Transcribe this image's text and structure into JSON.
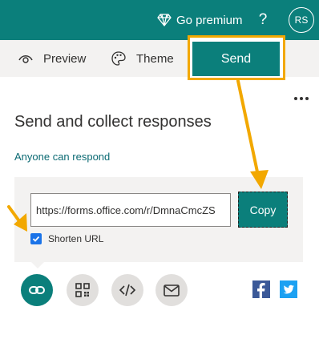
{
  "header": {
    "premium_label": "Go premium",
    "help_label": "?",
    "avatar_initials": "RS",
    "brand_color": "#0b7f7b"
  },
  "toolbar": {
    "preview_label": "Preview",
    "theme_label": "Theme",
    "send_label": "Send"
  },
  "main": {
    "title": "Send and collect responses",
    "audience_label": "Anyone can respond",
    "url_value": "https://forms.office.com/r/DmnaCmcZS",
    "copy_label": "Copy",
    "shorten_label": "Shorten URL",
    "shorten_checked": true
  },
  "share_icons": [
    "link-icon",
    "qr-code-icon",
    "embed-icon",
    "email-icon"
  ],
  "social_icons": [
    "facebook-icon",
    "twitter-icon"
  ],
  "annotation_color": "#f2a800"
}
